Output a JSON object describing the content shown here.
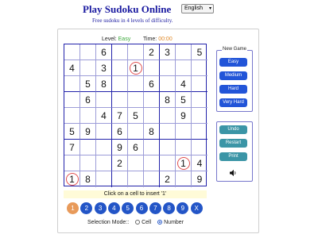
{
  "header": {
    "title": "Play Sudoku Online",
    "subtitle": "Free sudoku in 4 levels of difficulty.",
    "language": "English"
  },
  "status": {
    "level_label": "Level:",
    "level_value": "Easy",
    "time_label": "Time:",
    "time_value": "00:00"
  },
  "board": [
    [
      "",
      "",
      "6",
      "",
      "",
      "2",
      "3",
      "",
      "5"
    ],
    [
      "4",
      "",
      "3",
      "",
      "1",
      "",
      "",
      "",
      ""
    ],
    [
      "",
      "5",
      "8",
      "",
      "",
      "6",
      "",
      "4",
      ""
    ],
    [
      "",
      "6",
      "",
      "",
      "",
      "",
      "8",
      "5",
      ""
    ],
    [
      "",
      "",
      "4",
      "7",
      "5",
      "",
      "",
      "9",
      ""
    ],
    [
      "5",
      "9",
      "",
      "6",
      "",
      "8",
      "",
      "",
      ""
    ],
    [
      "7",
      "",
      "",
      "9",
      "6",
      "",
      "",
      "",
      ""
    ],
    [
      "",
      "",
      "",
      "2",
      "",
      "",
      "",
      "1",
      "4"
    ],
    [
      "1",
      "8",
      "",
      "",
      "",
      "",
      "2",
      "",
      "9"
    ]
  ],
  "highlighted_cells": [
    [
      1,
      4
    ],
    [
      7,
      7
    ],
    [
      8,
      0
    ]
  ],
  "hint": "Click on a cell to insert '1'",
  "number_buttons": [
    "1",
    "2",
    "3",
    "4",
    "5",
    "6",
    "7",
    "8",
    "9",
    "X"
  ],
  "active_number": "1",
  "selection_mode": {
    "label": "Selection Mode::",
    "options": [
      "Cell",
      "Number"
    ],
    "selected": "Number"
  },
  "new_game": {
    "legend": "New Game",
    "buttons": [
      "Easy",
      "Medium",
      "Hard",
      "Very Hard"
    ]
  },
  "actions": {
    "undo": "Undo",
    "restart": "Restart",
    "print": "Print"
  },
  "icons": {
    "sound": "speaker-icon",
    "language_arrow": "chevron-down-icon"
  },
  "colors": {
    "title": "#1a1aa0",
    "grid_border": "#2222aa",
    "level_easy": "#3aa83a",
    "timer": "#e08a2a",
    "number_button": "#2355c7",
    "number_button_active": "#e89a5a",
    "difficulty_button": "#2255d8",
    "action_button": "#3b95a6",
    "highlight_circle": "#e05050",
    "hint_background": "#fffbd8"
  }
}
